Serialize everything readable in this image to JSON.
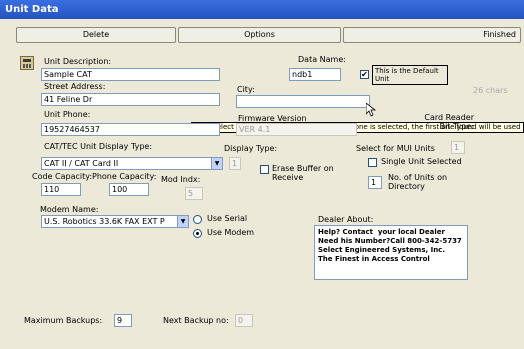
{
  "window": {
    "title": "Unit Data"
  },
  "toolbar": {
    "delete": "Delete",
    "options": "Options",
    "finished": "Finished"
  },
  "unit_description": {
    "label": "Unit Description:",
    "value": "Sample CAT"
  },
  "data_name": {
    "label": "Data Name:",
    "value": "ndb1"
  },
  "default_unit": {
    "label": "This is the Default Unit",
    "checked": true
  },
  "chars_count": "26 chars",
  "street_address": {
    "label": "Street Address:",
    "value": "41 Feline Dr"
  },
  "city": {
    "label": "City:"
  },
  "tooltip": "Only Select ONE unit as Default.  If more than one is selected, the first one found will be used",
  "unit_phone": {
    "label": "Unit Phone:",
    "value": "19527464537"
  },
  "firmware": {
    "label": "Firmware Version",
    "value": "VER 4.1"
  },
  "card_reader": {
    "label": "Card Reader\nBit Type:"
  },
  "display_type_label": "CAT/TEC Unit Display Type:",
  "display_type_label2": "Display Type:",
  "mui_units": {
    "label": "Select for MUI Units",
    "value": "1"
  },
  "unit_type_select": "CAT II / CAT Card II",
  "display_num": "1",
  "erase_buffer": {
    "label": "Erase Buffer on Receive"
  },
  "single_unit": {
    "label": "Single Unit Selected"
  },
  "num_units": {
    "value": "1",
    "label": "No. of Units on Directory"
  },
  "code_capacity": {
    "label": "Code  Capacity:",
    "value": "110"
  },
  "phone_capacity": {
    "label": "Phone Capacity:",
    "value": "100"
  },
  "mod_indx": {
    "label": "Mod Indx:",
    "value": "5"
  },
  "modem_name": {
    "label": "Modem Name:",
    "value": "U.S. Robotics 33.6K FAX EXT P"
  },
  "use_serial": "Use Serial",
  "use_modem": "Use Modem",
  "dealer_about": {
    "label": "Dealer About:",
    "text": "Help? Contact  your local Dealer\nNeed his Number?Call 800-342-5737\nSelect Engineered Systems, Inc.\nThe Finest in Access Control"
  },
  "max_backups": {
    "label": "Maximum Backups:",
    "value": "9"
  },
  "next_backup": {
    "label": "Next Backup no:",
    "value": "0"
  },
  "icons": {
    "unit_icon": "keypad-unit-icon",
    "cursor": "mouse-pointer-icon"
  }
}
